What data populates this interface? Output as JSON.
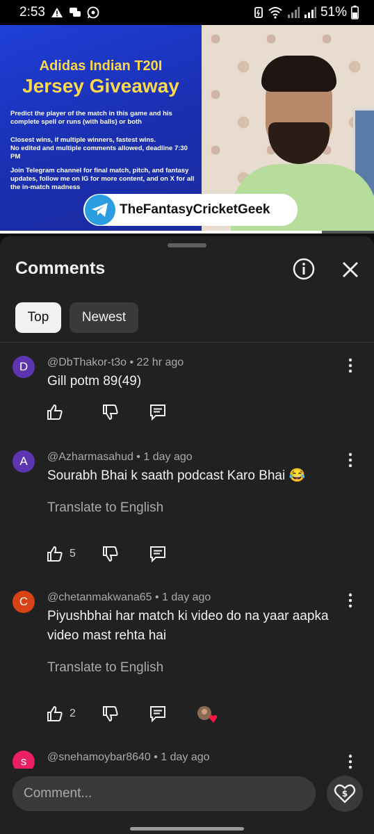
{
  "status_bar": {
    "time": "2:53",
    "battery": "51%"
  },
  "video": {
    "subtitle": "Adidas Indian T20I",
    "title": "Jersey Giveaway",
    "para1": "Predict the player of the match in this game and his complete spell or runs (with balls) or both",
    "para2": "Closest wins, if multiple winners, fastest wins.",
    "para3": "No edited and multiple comments allowed, deadline 7:30 PM",
    "para4": "Join Telegram channel for final match, pitch, and fantasy updates, follow me on IG for more content, and on X for all the in-match madness",
    "channel_name": "TheFantasyCricketGeek",
    "progress": 0.86
  },
  "comments_sheet": {
    "title": "Comments",
    "filters": [
      "Top",
      "Newest"
    ],
    "active_filter": "Top",
    "comments": [
      {
        "avatar_letter": "D",
        "avatar_color": "#5e35b1",
        "meta": "@DbThakor-t3o • 22 hr ago",
        "text": "Gill potm 89(49)",
        "likes": ""
      },
      {
        "avatar_letter": "A",
        "avatar_color": "#5e35b1",
        "meta": "@Azharmasahud • 1 day ago",
        "text": "Sourabh Bhai k saath podcast Karo Bhai 😂",
        "translate": "Translate to English",
        "likes": "5"
      },
      {
        "avatar_letter": "C",
        "avatar_color": "#d84315",
        "meta": "@chetanmakwana65 • 1 day ago",
        "text": "Piyushbhai har match ki video do na yaar aapka video mast rehta hai",
        "translate": "Translate to English",
        "likes": "2"
      },
      {
        "avatar_letter": "s",
        "avatar_color": "#e91e63",
        "meta": "@snehamoybar8640 • 1 day ago"
      }
    ],
    "input_placeholder": "Comment..."
  }
}
